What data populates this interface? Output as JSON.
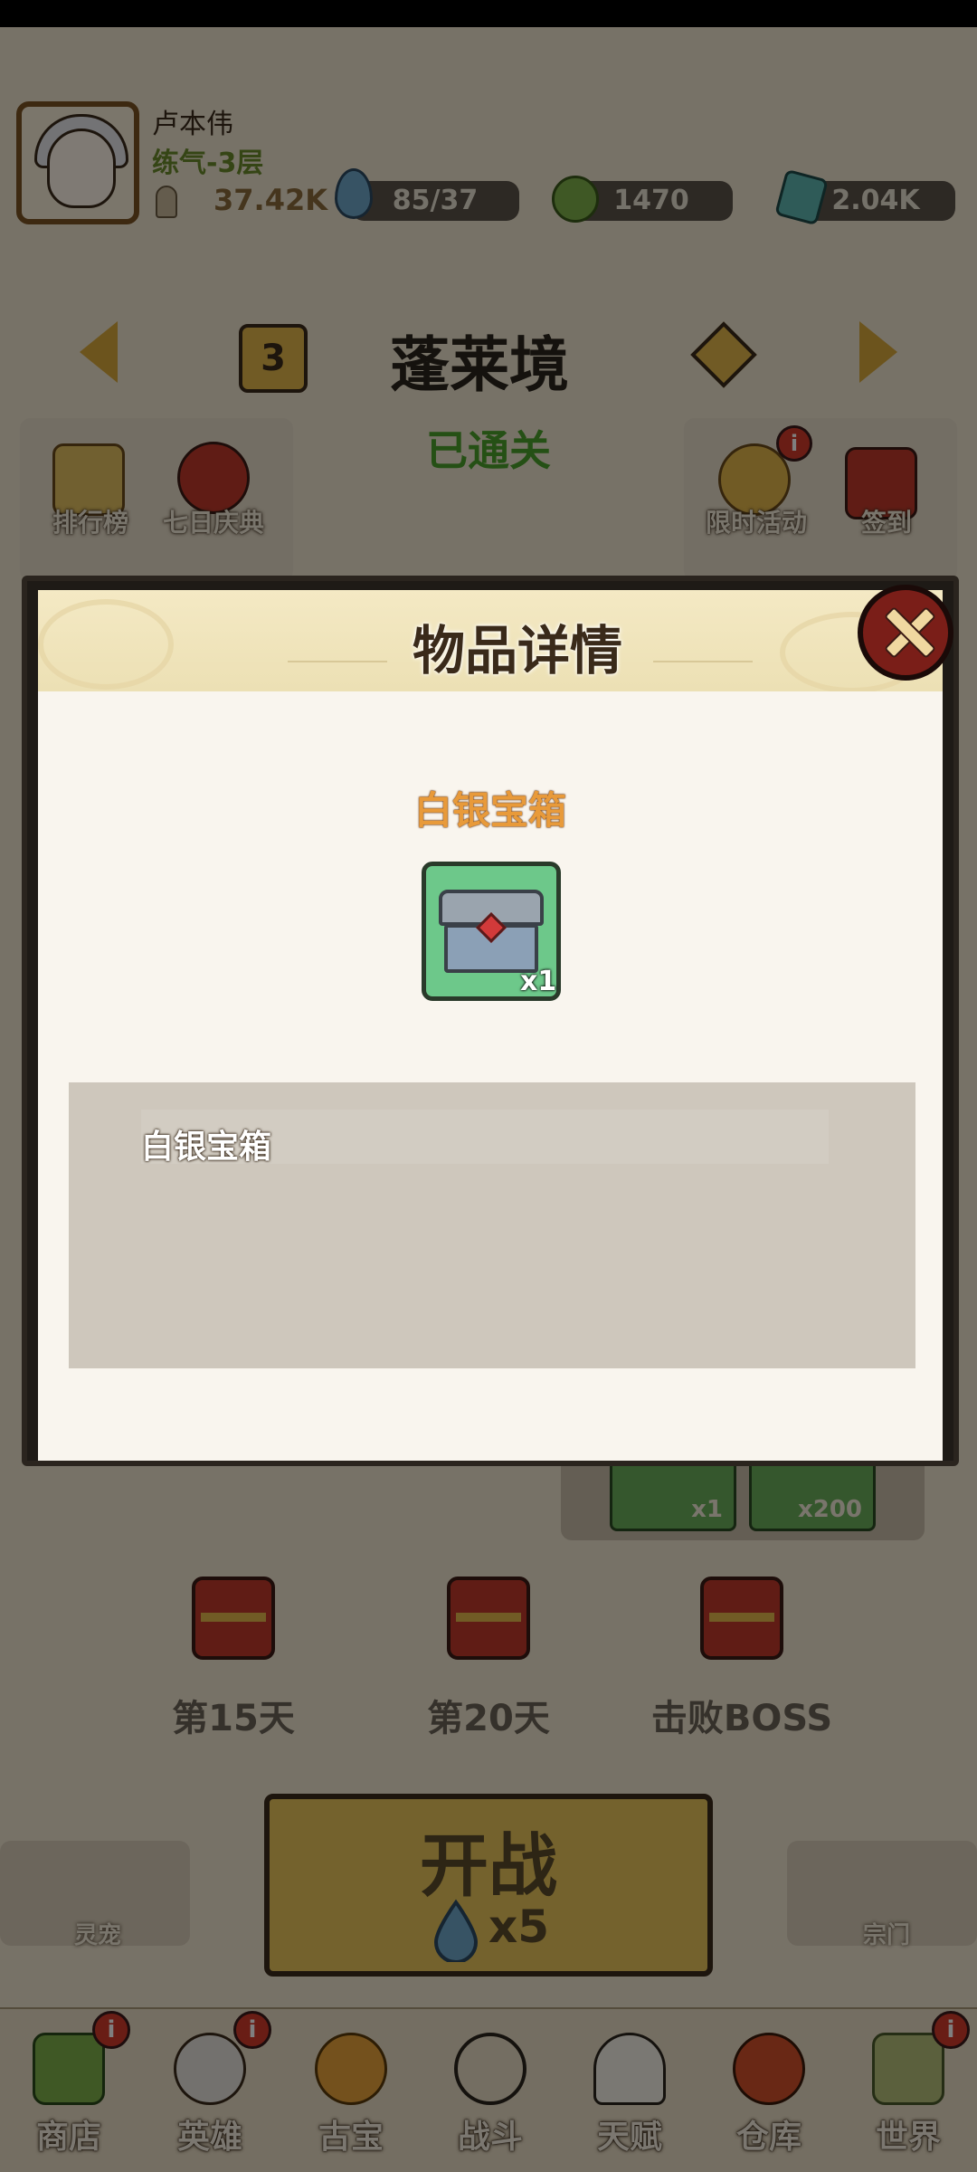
{
  "player": {
    "name": "卢本伟",
    "realm": "练气-3层",
    "power": "37.42K"
  },
  "resources": {
    "stamina": "85/37",
    "coins": "1470",
    "crystals": "2.04K"
  },
  "stage": {
    "number": "3",
    "name": "蓬莱境",
    "status": "已通关"
  },
  "left_buttons": [
    {
      "label": "排行榜"
    },
    {
      "label": "七日庆典"
    }
  ],
  "right_buttons": [
    {
      "label": "限时活动",
      "badge": "i"
    },
    {
      "label": "签到"
    }
  ],
  "reward_slots": [
    {
      "qty": "x1"
    },
    {
      "qty": "x200"
    }
  ],
  "milestones": [
    {
      "label": "第15天"
    },
    {
      "label": "第20天"
    },
    {
      "label": "击败BOSS"
    }
  ],
  "fight": {
    "label": "开战",
    "cost": "x5"
  },
  "side": {
    "pet_label": "灵宠",
    "sect_label": "宗门"
  },
  "nav": [
    {
      "label": "商店",
      "badge": "i"
    },
    {
      "label": "英雄",
      "badge": "i"
    },
    {
      "label": "古宝",
      "badge": ""
    },
    {
      "label": "战斗",
      "badge": ""
    },
    {
      "label": "天赋",
      "badge": ""
    },
    {
      "label": "仓库",
      "badge": ""
    },
    {
      "label": "世界",
      "badge": "i"
    }
  ],
  "modal": {
    "title": "物品详情",
    "item_name": "白银宝箱",
    "item_qty": "x1",
    "description": "白银宝箱"
  },
  "colors": {
    "item_name": "#e89a3a",
    "item_bg": "#6dc88a",
    "close_button": "#7a1e18"
  }
}
